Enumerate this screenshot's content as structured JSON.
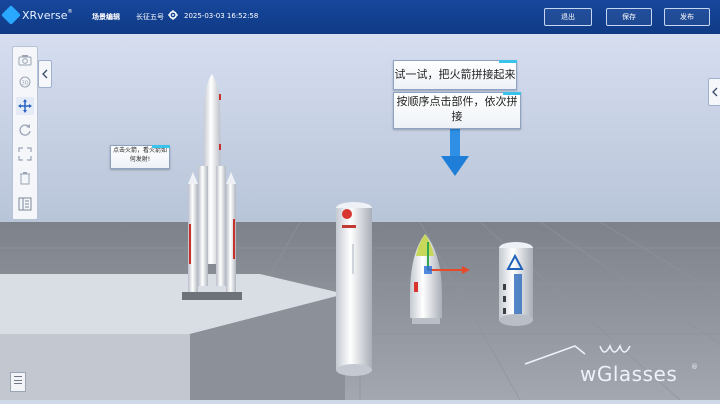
{
  "header": {
    "logo_text": "XRverse",
    "logo_sup": "®",
    "scene_edit_label": "场景编辑",
    "scene_name": "长征五号",
    "timestamp": "2025-03-03 16:52:58",
    "buttons": {
      "exit": "退出",
      "save": "保存",
      "publish": "发布"
    },
    "settings_icon": "gear-icon"
  },
  "toolbar": {
    "tools": [
      "camera-icon",
      "reset-view-icon",
      "move-icon",
      "rotate-icon",
      "scale-icon",
      "delete-icon",
      "panel-icon"
    ]
  },
  "scene": {
    "callout_small": "点击火箭，看火箭如何发射!",
    "callout_1": "试一试，把火箭拼接起来",
    "callout_2": "按顺序点击部件，依次拼接",
    "watermark": "wGlasses",
    "watermark_sup": "®"
  },
  "colors": {
    "header": "#17479c",
    "accent": "#39c2ea",
    "arrow": "#1f8fe6"
  }
}
